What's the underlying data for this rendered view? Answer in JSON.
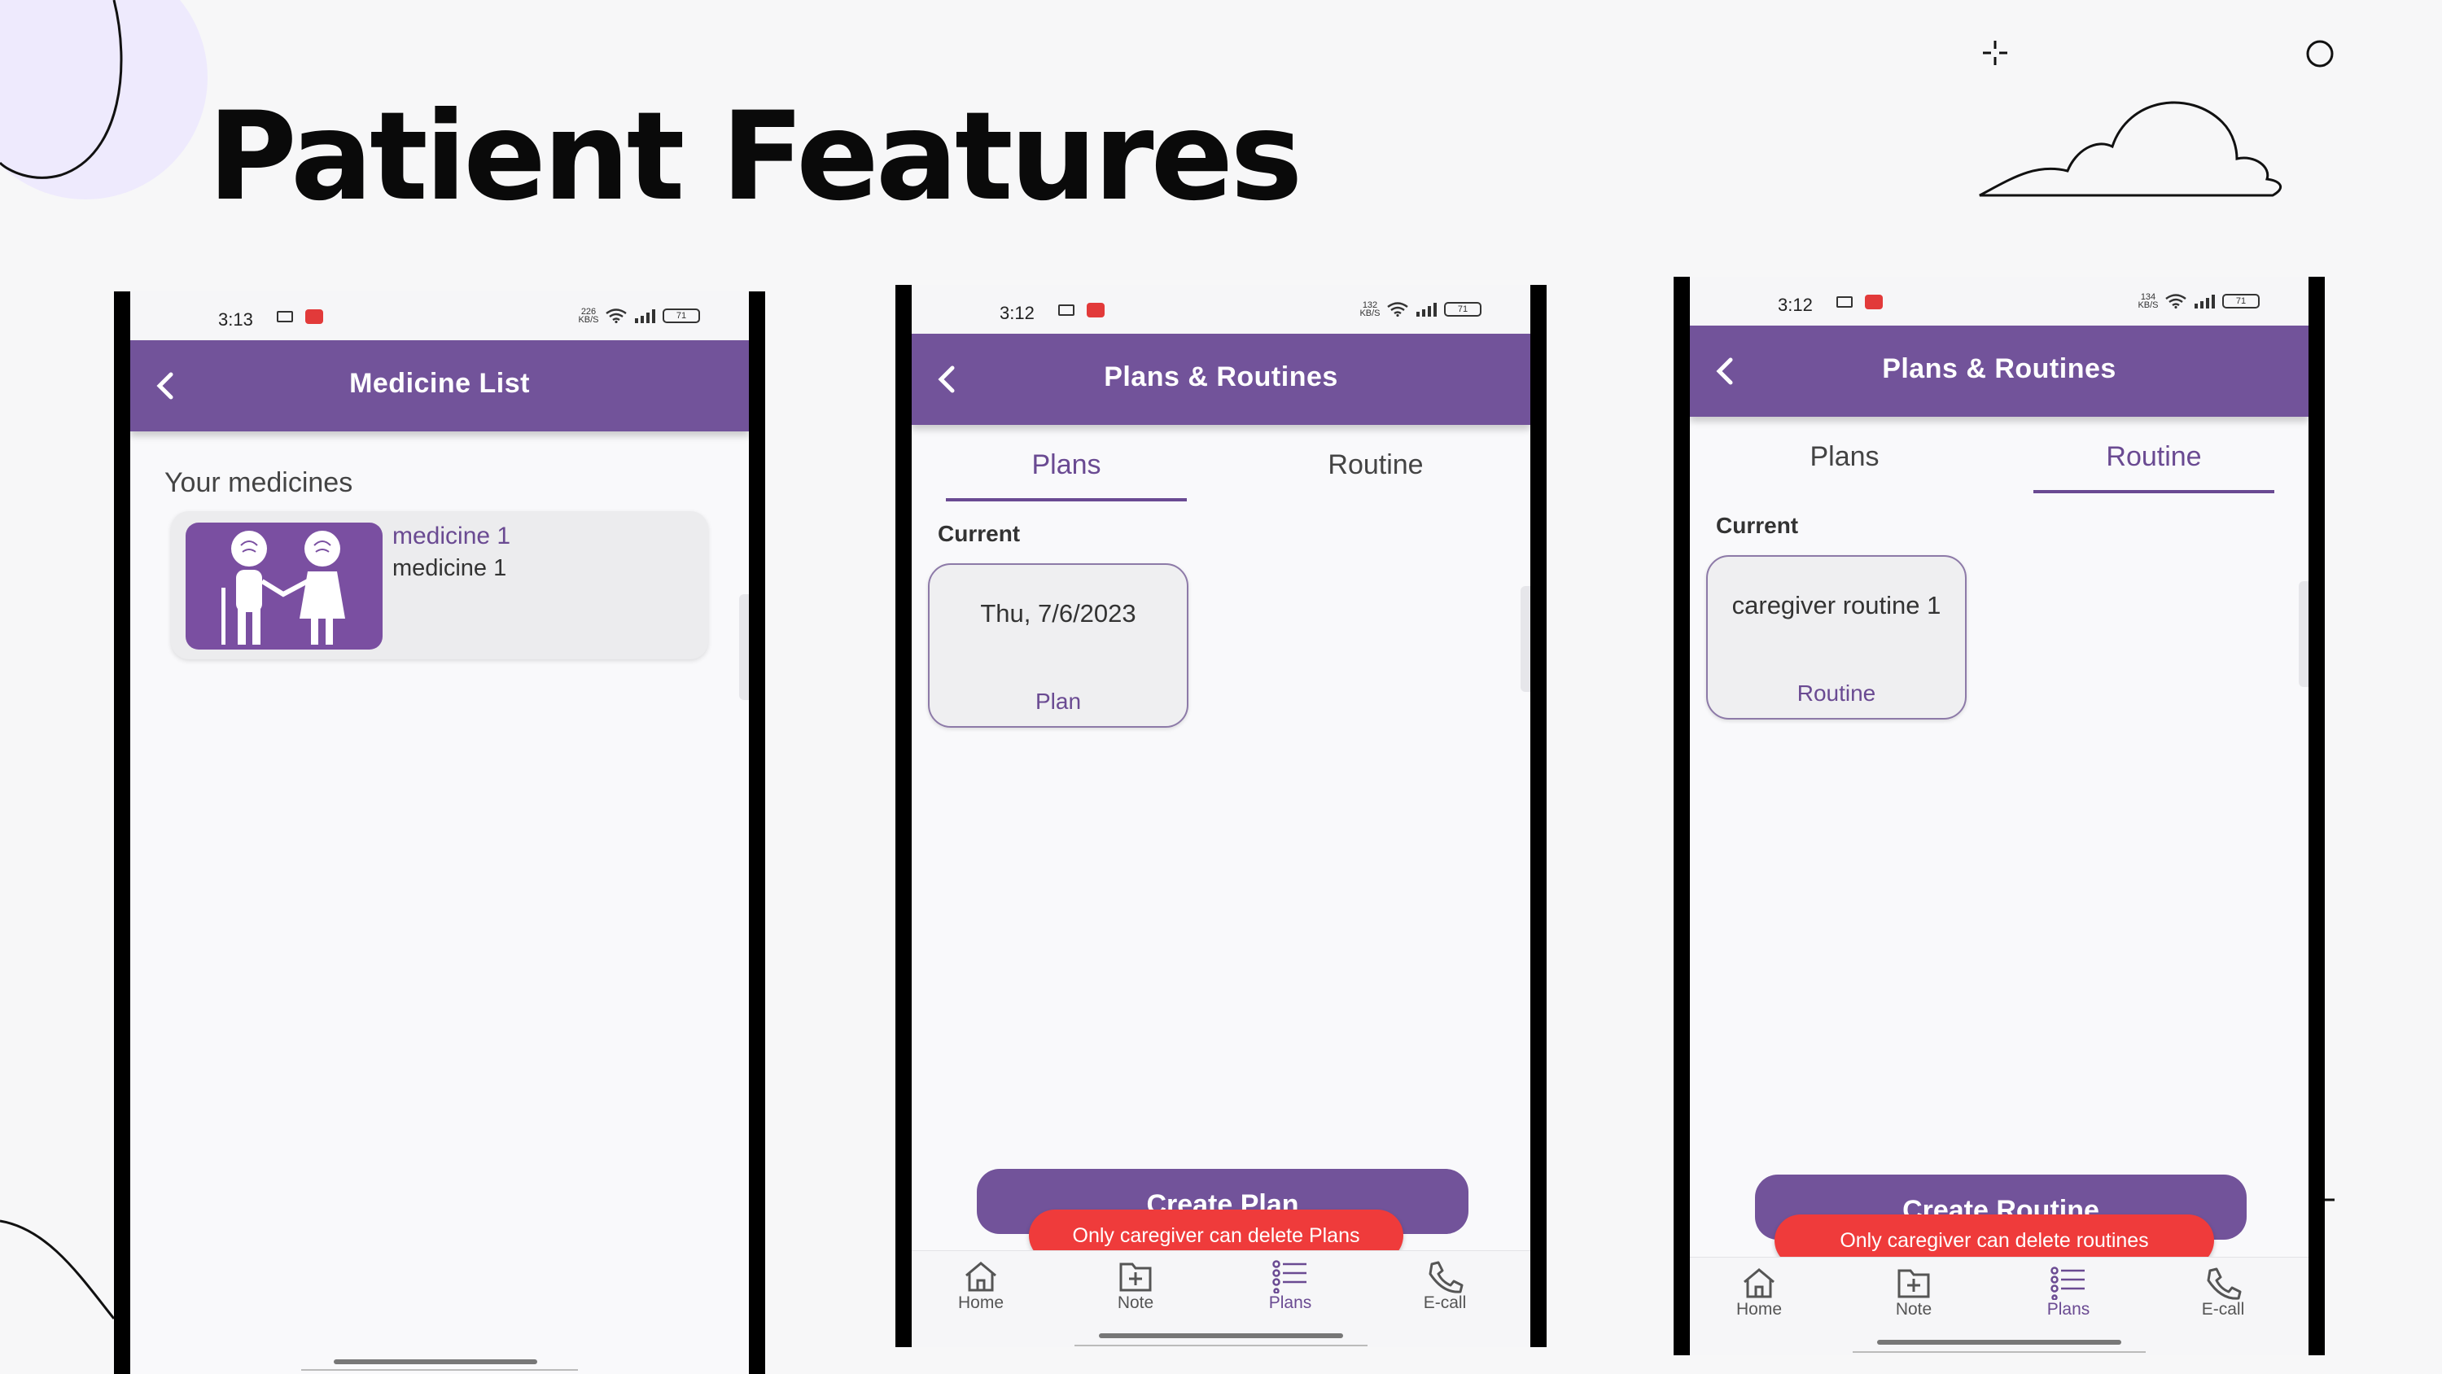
{
  "slide": {
    "title": "Patient Features"
  },
  "phone1": {
    "status": {
      "time": "3:13",
      "net": "226 KB/S",
      "battery": "71"
    },
    "appbar_title": "Medicine List",
    "section_label": "Your medicines",
    "medicine": {
      "name": "medicine 1",
      "description": "medicine 1"
    }
  },
  "phone2": {
    "status": {
      "time": "3:12",
      "net": "132 KB/S",
      "battery": "71"
    },
    "appbar_title": "Plans & Routines",
    "tabs": [
      "Plans",
      "Routine"
    ],
    "active_tab": "Plans",
    "current_label": "Current",
    "card": {
      "title": "Thu, 7/6/2023",
      "type": "Plan"
    },
    "create_button": "Create Plan",
    "snackbar": "Only caregiver can delete Plans",
    "nav": [
      "Home",
      "Note",
      "Plans",
      "E-call"
    ]
  },
  "phone3": {
    "status": {
      "time": "3:12",
      "net": "134 KB/S",
      "battery": "71"
    },
    "appbar_title": "Plans & Routines",
    "tabs": [
      "Plans",
      "Routine"
    ],
    "active_tab": "Routine",
    "current_label": "Current",
    "card": {
      "title": "caregiver routine 1",
      "type": "Routine"
    },
    "create_button": "Create Routine",
    "snackbar": "Only caregiver can delete routines",
    "nav": [
      "Home",
      "Note",
      "Plans",
      "E-call"
    ]
  },
  "colors": {
    "primary": "#72539a",
    "snackbar": "#ef3b3b",
    "accent_text": "#6a4a92"
  },
  "icons": [
    "back-arrow-icon",
    "home-icon",
    "note-add-icon",
    "plans-list-icon",
    "phone-call-icon",
    "wifi-icon",
    "signal-icon",
    "battery-icon"
  ]
}
